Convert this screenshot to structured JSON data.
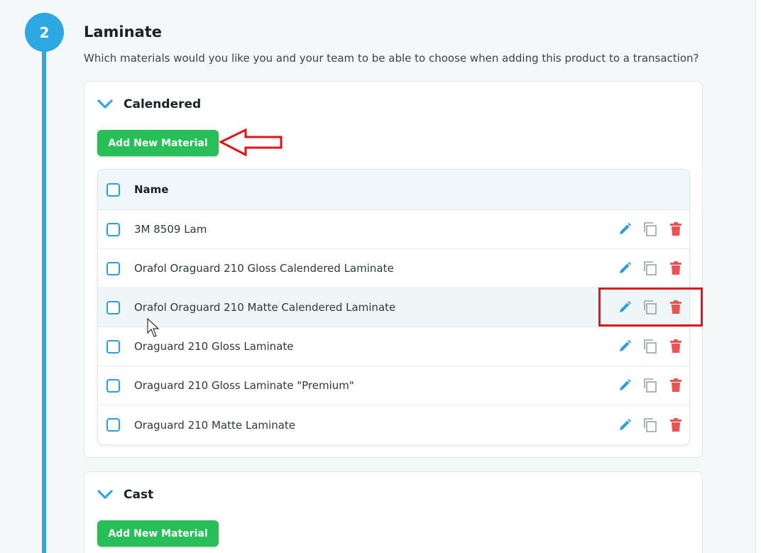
{
  "step": {
    "number": "2",
    "title": "Laminate",
    "description": "Which materials would you like you and your team to be able to choose when adding this product to a transaction?"
  },
  "groups": [
    {
      "title": "Calendered",
      "add_button": "Add New Material",
      "table": {
        "header": "Name",
        "rows": [
          {
            "name": "3M 8509 Lam"
          },
          {
            "name": "Orafol Oraguard 210 Gloss Calendered Laminate"
          },
          {
            "name": "Orafol Oraguard 210 Matte Calendered Laminate"
          },
          {
            "name": "Oraguard 210 Gloss Laminate"
          },
          {
            "name": "Oraguard 210 Gloss Laminate \"Premium\""
          },
          {
            "name": "Oraguard 210 Matte Laminate"
          }
        ]
      }
    },
    {
      "title": "Cast",
      "add_button": "Add New Material"
    }
  ],
  "icons": {
    "edit": "pencil-icon",
    "duplicate": "copy-icon",
    "delete": "trash-icon"
  },
  "colors": {
    "accent": "#2ea8e2",
    "button": "#27bf57",
    "delete": "#ea5353",
    "annotation": "#e0141b"
  }
}
